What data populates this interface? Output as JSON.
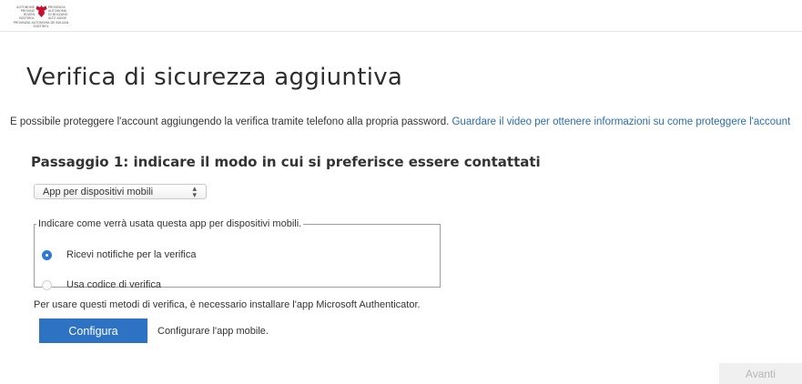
{
  "header": {
    "logo": {
      "left_text": "AUTONOME\nPROVINZ\nBOZEN\nSÜDTIROL",
      "right_text": "PROVINCIA\nAUTONOMA\nDI BOLZANO\nALTO ADIGE",
      "bottom_text": "PROVINZIA AUTONOMA DE BULSAN\nSÜDTIROL",
      "icon": "tyrolean-eagle-icon",
      "eagle_color": "#c8102e"
    }
  },
  "main": {
    "title": "Verifica di sicurezza aggiuntiva",
    "intro_text": "È possibile proteggere l'account aggiungendo la verifica tramite telefono alla propria password. ",
    "intro_link": "Guardare il video per ottenere informazioni su come proteggere l'account",
    "step_title": "Passaggio 1: indicare il modo in cui si preferisce essere contattati",
    "method_select": {
      "selected": "App per dispositivi mobili"
    },
    "options": {
      "legend": "Indicare come verrà usata questa app per dispositivi mobili.",
      "items": [
        {
          "label": "Ricevi notifiche per la verifica",
          "selected": true
        },
        {
          "label": "Usa codice di verifica",
          "selected": false
        }
      ]
    },
    "install_note": "Per usare questi metodi di verifica, è necessario installare l'app Microsoft Authenticator.",
    "configure_button": "Configura",
    "configure_hint": "Configurare l'app mobile.",
    "next_button": "Avanti"
  },
  "colors": {
    "accent": "#2e73c3",
    "link": "#2a6db3",
    "radio_selected": "#2d7ad6",
    "disabled_button_bg": "#f0f0f0",
    "disabled_button_text": "#b5b5b5"
  }
}
